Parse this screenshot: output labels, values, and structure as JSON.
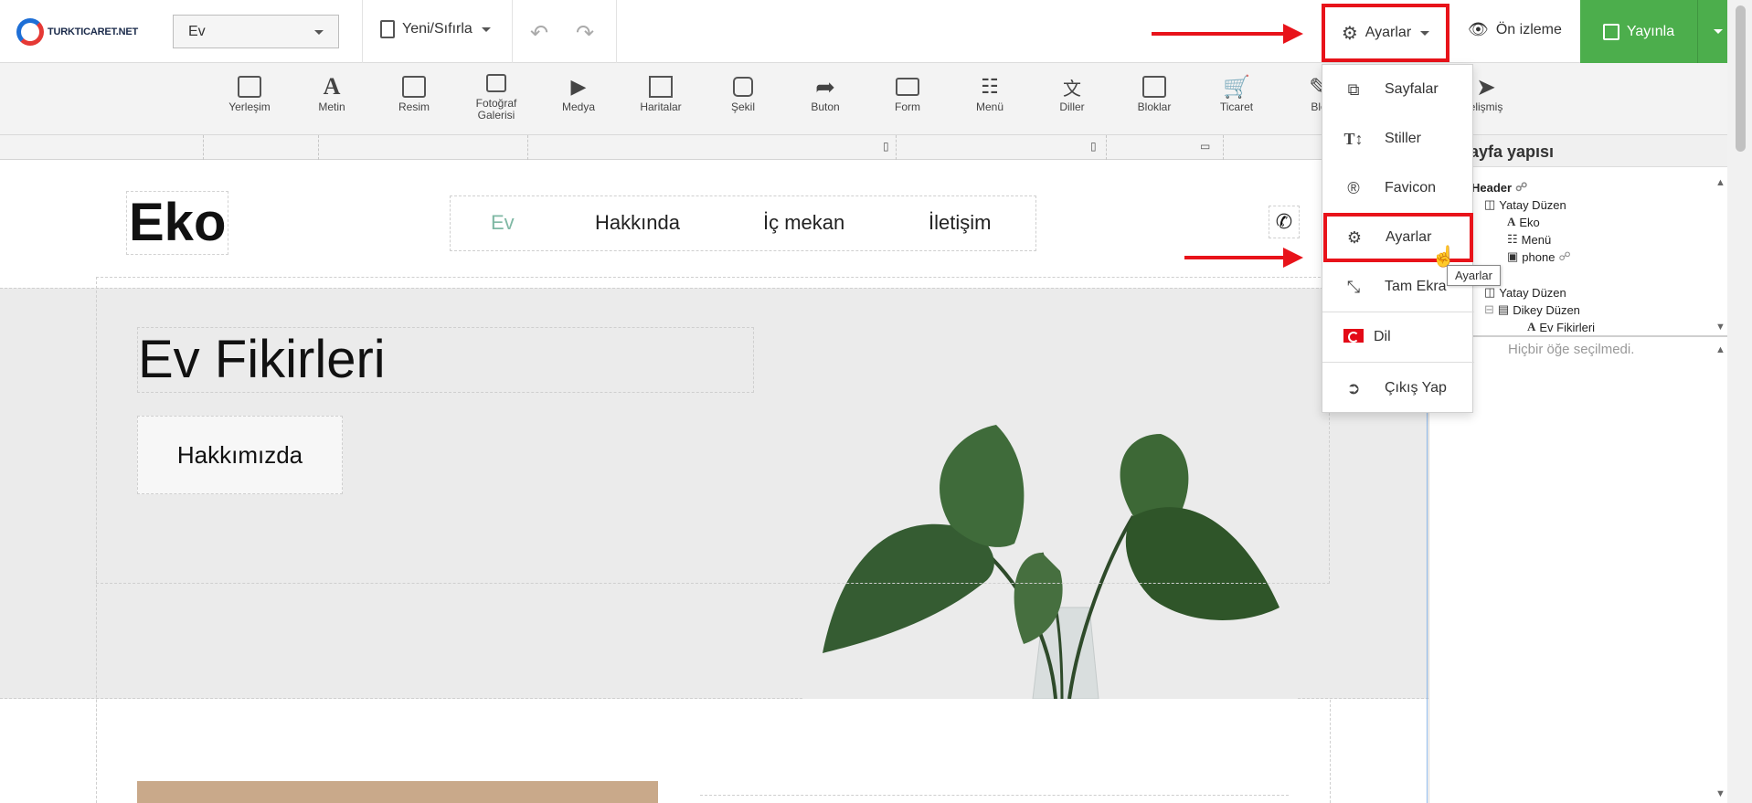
{
  "topbar": {
    "logo_text": "TURKTICARET.NET",
    "page_select_value": "Ev",
    "new_reset_label": "Yeni/Sıfırla",
    "settings_label": "Ayarlar",
    "preview_label": "Ön izleme",
    "publish_label": "Yayınla"
  },
  "toolbar": {
    "items": [
      {
        "label": "Yerleşim",
        "icon": "layout-icon"
      },
      {
        "label": "Metin",
        "icon": "text-icon"
      },
      {
        "label": "Resim",
        "icon": "image-icon"
      },
      {
        "label": "Fotoğraf Galerisi",
        "icon": "gallery-icon"
      },
      {
        "label": "Medya",
        "icon": "media-icon"
      },
      {
        "label": "Haritalar",
        "icon": "map-icon"
      },
      {
        "label": "Şekil",
        "icon": "shape-icon"
      },
      {
        "label": "Buton",
        "icon": "button-icon"
      },
      {
        "label": "Form",
        "icon": "form-icon"
      },
      {
        "label": "Menü",
        "icon": "menu-icon"
      },
      {
        "label": "Diller",
        "icon": "languages-icon"
      },
      {
        "label": "Bloklar",
        "icon": "blocks-icon"
      },
      {
        "label": "Ticaret",
        "icon": "cart-icon"
      },
      {
        "label": "Blo",
        "icon": "blog-icon"
      },
      {
        "label": "elişmiş",
        "icon": "rocket-icon"
      }
    ]
  },
  "site": {
    "brand": "Eko",
    "menu": [
      "Ev",
      "Hakkında",
      "İç mekan",
      "İletişim"
    ],
    "menu_active_color": "#7fb8a4",
    "hero_title": "Ev Fikirleri",
    "hero_button": "Hakkımızda"
  },
  "panel": {
    "title": "ayfa yapısı",
    "tree": [
      "Header",
      "Yatay Düzen",
      "Eko",
      "Menü",
      "phone",
      "y",
      "Yatay Düzen",
      "Dikey Düzen",
      "Ev Fikirleri"
    ],
    "empty_text": "Hiçbir öğe seçilmedi."
  },
  "dropdown": {
    "items": [
      {
        "label": "Sayfalar",
        "icon": "pages-icon"
      },
      {
        "label": "Stiller",
        "icon": "styles-icon"
      },
      {
        "label": "Favicon",
        "icon": "registered-icon"
      },
      {
        "label": "Ayarlar",
        "icon": "gear-icon"
      },
      {
        "label": "Tam Ekra",
        "icon": "fullscreen-icon"
      },
      {
        "label": "Dil",
        "icon": "flag-icon"
      },
      {
        "label": "Çıkış Yap",
        "icon": "logout-icon"
      }
    ],
    "tooltip": "Ayarlar"
  },
  "colors": {
    "highlight": "#e8131a",
    "publish": "#4cae4c"
  }
}
